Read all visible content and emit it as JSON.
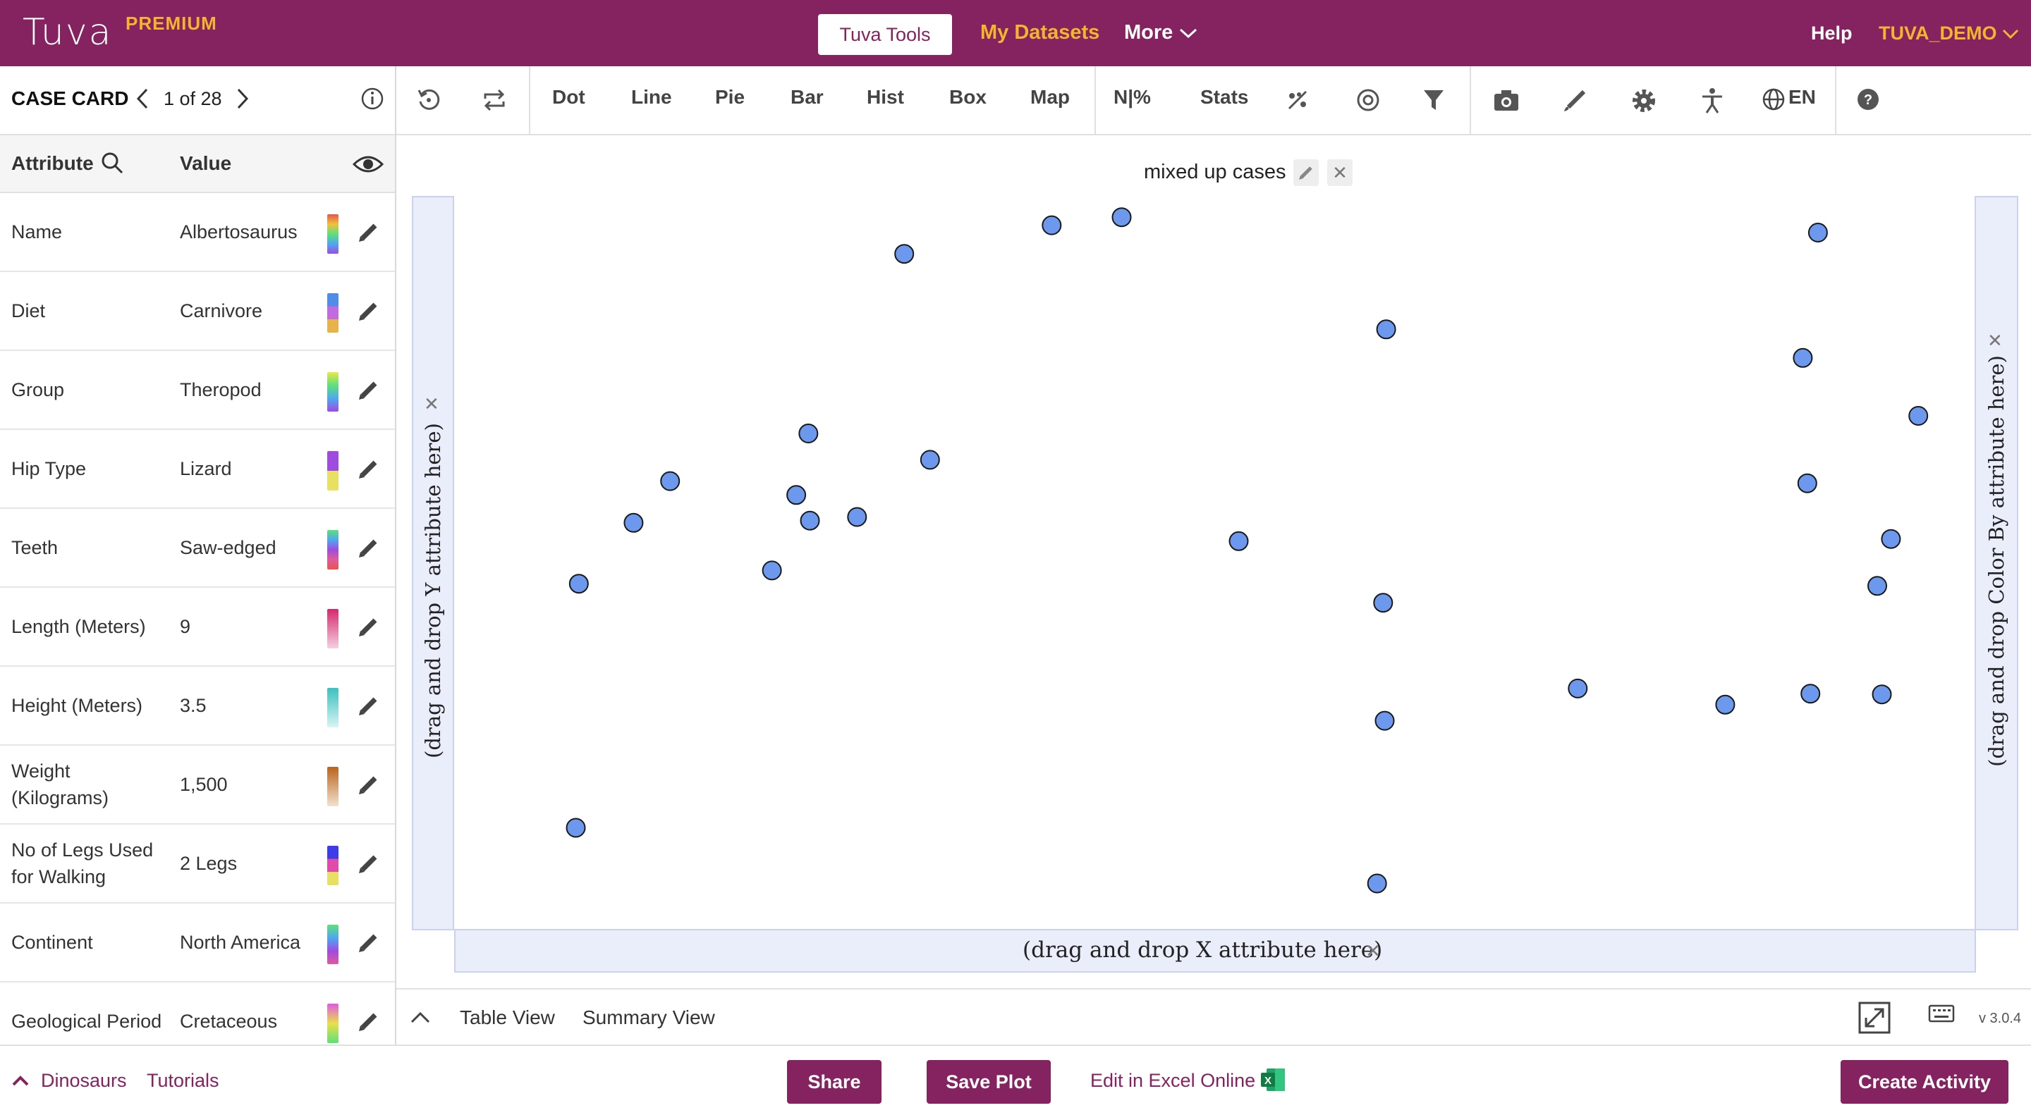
{
  "topbar": {
    "brand": "Tuva",
    "premium": "PREMIUM",
    "tools_button": "Tuva Tools",
    "datasets_link": "My Datasets",
    "more_menu": "More",
    "help_link": "Help",
    "user_menu": "TUVA_DEMO"
  },
  "case_card": {
    "title": "CASE CARD",
    "count": "1 of 28",
    "header_attribute": "Attribute",
    "header_value": "Value",
    "rows": [
      {
        "name": "Name",
        "value": "Albertosaurus",
        "swatch": "linear-gradient(#e8554e,#f0c23a,#5ee07a,#4da8f0,#a04be0)"
      },
      {
        "name": "Diet",
        "value": "Carnivore",
        "swatch": "linear-gradient(#4f8de8 0%,#4f8de8 33%,#c26ae0 33%,#c26ae0 66%,#e8b34a 66%)"
      },
      {
        "name": "Group",
        "value": "Theropod",
        "swatch": "linear-gradient(#e8e84a,#5ee07a,#4da8f0,#a04be0)"
      },
      {
        "name": "Hip Type",
        "value": "Lizard",
        "swatch": "linear-gradient(#a04be0 0%,#a04be0 50%,#e8e060 50%)"
      },
      {
        "name": "Teeth",
        "value": "Saw-edged",
        "swatch": "linear-gradient(#5ee07a,#4da8f0,#a04be0,#e05a9a,#e8554e)"
      },
      {
        "name": "Length (Meters)",
        "value": "9",
        "swatch": "linear-gradient(#d6286e,#f4d0e0)"
      },
      {
        "name": "Height (Meters)",
        "value": "3.5",
        "swatch": "linear-gradient(#3cc0c0,#d8f4f4)"
      },
      {
        "name": "Weight (Kilograms)",
        "value": "1,500",
        "swatch": "linear-gradient(#b8641c,#f2e2cf)"
      },
      {
        "name": "No of Legs Used for Walking",
        "value": "2 Legs",
        "swatch": "linear-gradient(#3c3ce8 0%,#3c3ce8 33%,#e04aa8 33%,#e04aa8 66%,#e8e060 66%)"
      },
      {
        "name": "Continent",
        "value": "North America",
        "swatch": "linear-gradient(#5ee07a,#4da8f0,#a04be0,#e05a9a)"
      },
      {
        "name": "Geological Period",
        "value": "Cretaceous",
        "swatch": "linear-gradient(#e05ae0,#e8e04a,#5ee07a)"
      }
    ]
  },
  "toolbar": {
    "items": [
      "Dot",
      "Line",
      "Pie",
      "Bar",
      "Hist",
      "Box",
      "Map",
      "N|%",
      "Stats"
    ],
    "lang": "EN"
  },
  "plot": {
    "title": "mixed up cases",
    "y_drop": "(drag and drop Y attribute here)",
    "x_drop": "(drag and drop X attribute here)",
    "color_drop": "(drag and drop Color By attribute here)",
    "point_color": "#6c99ee",
    "point_stroke": "#1a1a1a"
  },
  "chart_data": {
    "type": "scatter",
    "note_axes": "no attributes assigned; cases randomly placed",
    "points": [
      [
        0.118,
        0.446
      ],
      [
        0.142,
        0.389
      ],
      [
        0.082,
        0.529
      ],
      [
        0.08,
        0.862
      ],
      [
        0.209,
        0.511
      ],
      [
        0.225,
        0.408
      ],
      [
        0.233,
        0.324
      ],
      [
        0.234,
        0.443
      ],
      [
        0.265,
        0.438
      ],
      [
        0.296,
        0.079
      ],
      [
        0.313,
        0.36
      ],
      [
        0.393,
        0.04
      ],
      [
        0.439,
        0.029
      ],
      [
        0.516,
        0.471
      ],
      [
        0.613,
        0.182
      ],
      [
        0.611,
        0.555
      ],
      [
        0.612,
        0.716
      ],
      [
        0.607,
        0.938
      ],
      [
        0.739,
        0.672
      ],
      [
        0.836,
        0.694
      ],
      [
        0.892,
        0.679
      ],
      [
        0.897,
        0.05
      ],
      [
        0.887,
        0.221
      ],
      [
        0.89,
        0.392
      ],
      [
        0.963,
        0.3
      ],
      [
        0.945,
        0.468
      ],
      [
        0.936,
        0.532
      ],
      [
        0.939,
        0.68
      ]
    ]
  },
  "view_strip": {
    "table_view": "Table View",
    "summary_view": "Summary View",
    "version": "v 3.0.4"
  },
  "footer": {
    "dataset": "Dinosaurs",
    "tutorials": "Tutorials",
    "share": "Share",
    "save_plot": "Save Plot",
    "excel": "Edit in Excel Online",
    "create_activity": "Create Activity"
  }
}
